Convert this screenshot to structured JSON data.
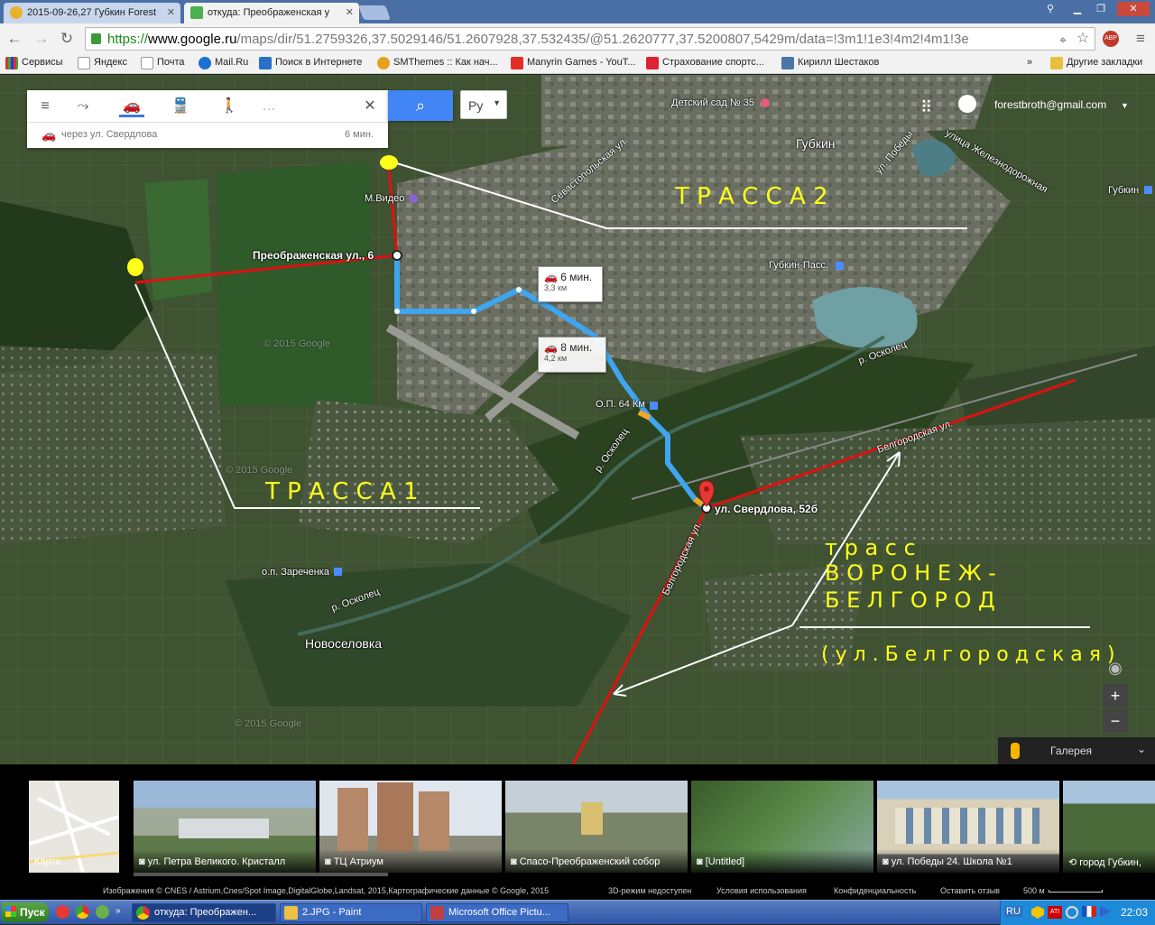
{
  "browser": {
    "tabs": [
      {
        "label": "2015-09-26,27 Губкин Forest"
      },
      {
        "label": "откуда: Преображенская у"
      }
    ],
    "url": {
      "scheme": "https://",
      "host": "www.google.ru",
      "path": "/maps/dir/51.2759326,37.5029146/51.2607928,37.532435/@51.2620777,37.5200807,5429m/data=!3m1!1e3!4m2!4m1!3e"
    },
    "bookmarks": [
      "Сервисы",
      "Яндекс",
      "Почта",
      "Mail.Ru",
      "Поиск в Интернете",
      "SMThemes :: Как нач...",
      "Manyrin Games - YouT...",
      "Страхование спортс...",
      "Кирилл Шестаков"
    ],
    "bookmarks_more": "»",
    "bookmarks_other": "Другие закладки"
  },
  "maps": {
    "route_summary": "через ул. Свердлова",
    "route_time": "6 мин.",
    "language": "Ру",
    "account": "forestbroth@gmail.com",
    "callouts": [
      {
        "time": "6 мин.",
        "distance": "3,3 км"
      },
      {
        "time": "8 мин.",
        "distance": "4,2 км"
      }
    ],
    "labels": {
      "start": "Преображенская ул., 6",
      "end": "ул. Свердлова, 52б",
      "mvideo": "М.Видео",
      "city": "Губкин",
      "kindergarten": "Детский сад № 35",
      "gubkin_pass": "Губкин-Пасс.",
      "gubkin_station": "Губкин",
      "op64": "О.П. 64 Км",
      "oskolets1": "р. Осколец",
      "oskolets2": "р. Осколец",
      "oskolets3": "р. Осколец",
      "zarechenka": "о.п. Заречeнка",
      "novoselovka": "Новоселовка",
      "sevastopolskaya": "Севастопольская ул.",
      "pobedy": "ул. Победы",
      "zheleznodorozhnaya": "улица Железнодорожная",
      "belgorodskaya_road": "Белгородская ул.",
      "belgorodskaya_road2": "Белгородская ул.",
      "copyright1": "© 2015 Google",
      "copyright2": "© 2015 Google",
      "copyright3": "© 2015 Google"
    },
    "annotations": {
      "trassa1": "Т Р А С С А 1",
      "trassa2": "Т Р А С С А 2",
      "voronezh1": "т р а с с",
      "voronezh2": "В О Р О Н Е Ж -",
      "voronezh3": "Б Е Л Г О Р О Д",
      "belgorodskaya": "( у л . Б е л г о р о д с к а я )"
    },
    "zoom_in": "+",
    "zoom_out": "−",
    "gallery": "Галерея",
    "thumbnails": [
      {
        "caption": "Карта"
      },
      {
        "caption": "ул. Петра Великого. Кристалл"
      },
      {
        "caption": "ТЦ Атриум"
      },
      {
        "caption": "Спасо-Преображенский собор"
      },
      {
        "caption": "[Untitled]"
      },
      {
        "caption": "ул. Победы 24. Школа №1"
      },
      {
        "caption": "город Губкин, "
      }
    ],
    "footer": {
      "imagery": "Изображения © CNES / Astrium,Cnes/Spot Image,DigitalGlobe,Landsat, 2015,Картографические данные © Google, 2015",
      "mode3d": "3D-режим недоступен",
      "terms": "Условия использования",
      "privacy": "Конфиденциальность",
      "feedback": "Оставить отзыв",
      "scale": "500 м"
    }
  },
  "taskbar": {
    "start": "Пуск",
    "tasks": [
      "откуда: Преображен...",
      "2.JPG - Paint",
      "Microsoft Office Pictu..."
    ],
    "lang": "RU",
    "time": "22:03"
  },
  "colors": {
    "route_blue": "#3ea5ee",
    "road_red": "#e01010",
    "annotation_yellow": "#ffff1a",
    "accent": "#4285f4"
  }
}
